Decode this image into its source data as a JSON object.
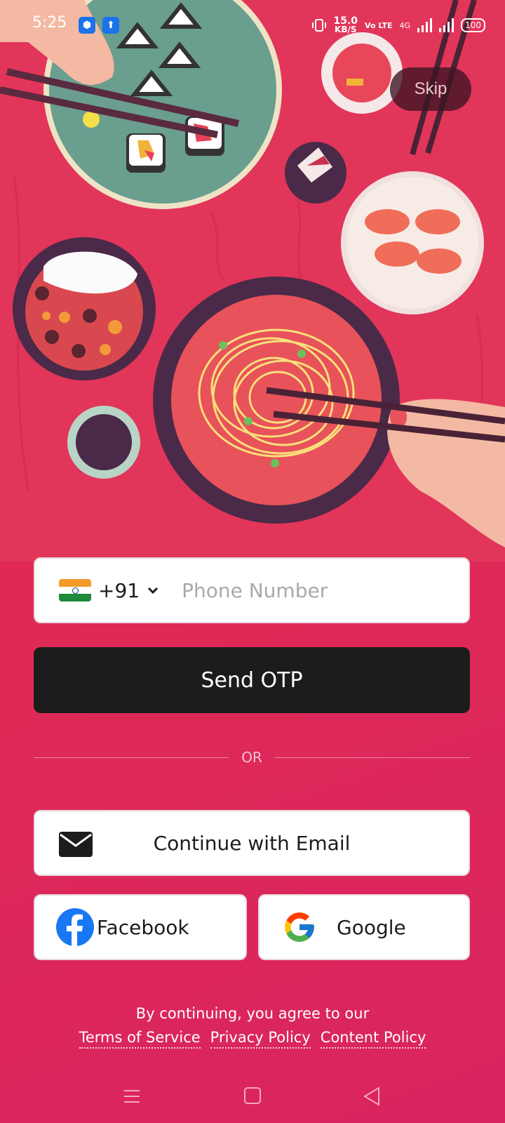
{
  "status_bar": {
    "time": "5:25",
    "net_speed_value": "15.0",
    "net_speed_unit": "KB/S",
    "volte": "Vo LTE",
    "network": "4G",
    "battery": "100"
  },
  "skip_label": "Skip",
  "phone": {
    "country_code": "+91",
    "placeholder": "Phone Number",
    "value": ""
  },
  "send_otp_label": "Send OTP",
  "or_label": "OR",
  "email_label": "Continue with Email",
  "facebook_label": "Facebook",
  "google_label": "Google",
  "legal": {
    "text": "By continuing, you agree to our",
    "terms": "Terms of Service",
    "privacy": "Privacy Policy",
    "content": "Content Policy"
  },
  "colors": {
    "background": "#e02a55",
    "button_dark": "#1c1c1c",
    "facebook": "#1877f2"
  },
  "icons": [
    "android-icon",
    "usb-icon",
    "vibrate-icon",
    "signal-icon",
    "battery-icon",
    "chevron-down-icon",
    "email-icon",
    "facebook-icon",
    "google-icon",
    "menu-icon",
    "home-icon",
    "back-icon"
  ]
}
